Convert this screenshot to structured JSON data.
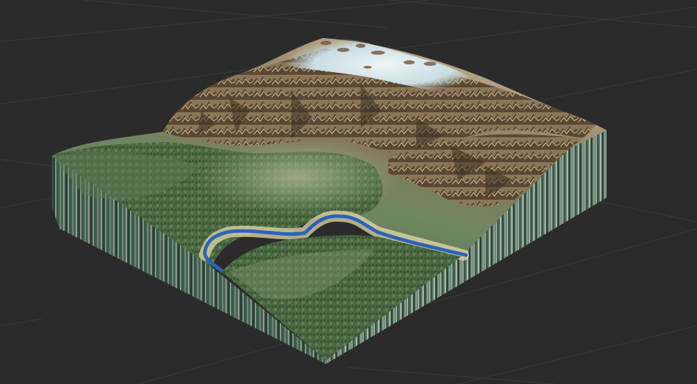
{
  "viewport": {
    "background_color": "#2b2b2b",
    "grid_color": "#3a3a3a"
  },
  "terrain": {
    "object_name": "terrain-heightmap",
    "colors": {
      "forest": "#4d6b43",
      "forest_dark": "#2f4a2b",
      "valley_floor": "#8fa07a",
      "rock": "#8b7658",
      "rock_shadow": "#4a3c2c",
      "snow": "#d9e6ea",
      "river": "#2a64b8",
      "river_bank": "#e6d8a8",
      "side_wall_a": "#6f8a78",
      "side_wall_b": "#3e5a4d",
      "side_wall_c": "#a7b7a8"
    }
  }
}
